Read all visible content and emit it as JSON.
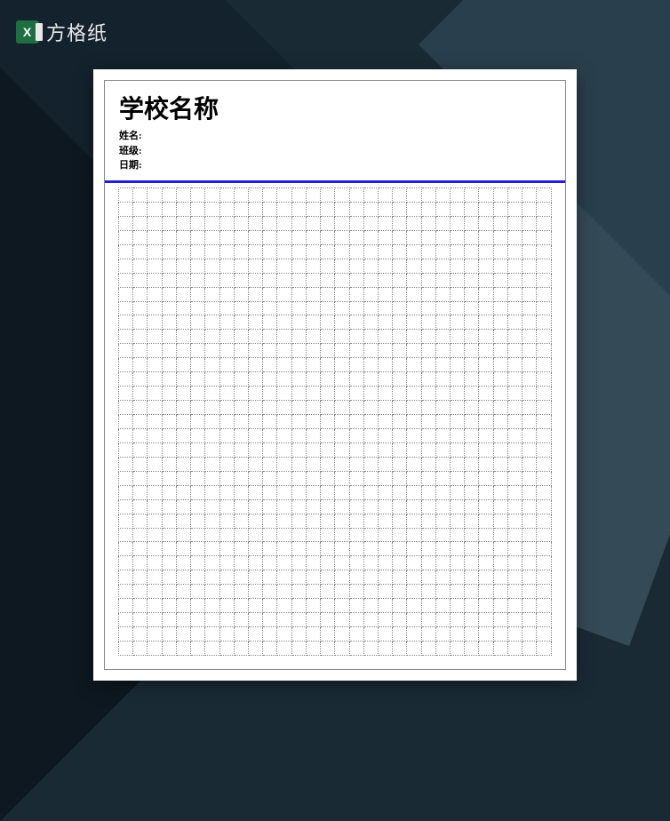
{
  "watermark": {
    "text": "方格纸"
  },
  "document": {
    "title": "学校名称",
    "fields": {
      "name_label": "姓名:",
      "class_label": "班级:",
      "date_label": "日期:"
    },
    "grid": {
      "columns": 30,
      "rows": 33
    }
  }
}
